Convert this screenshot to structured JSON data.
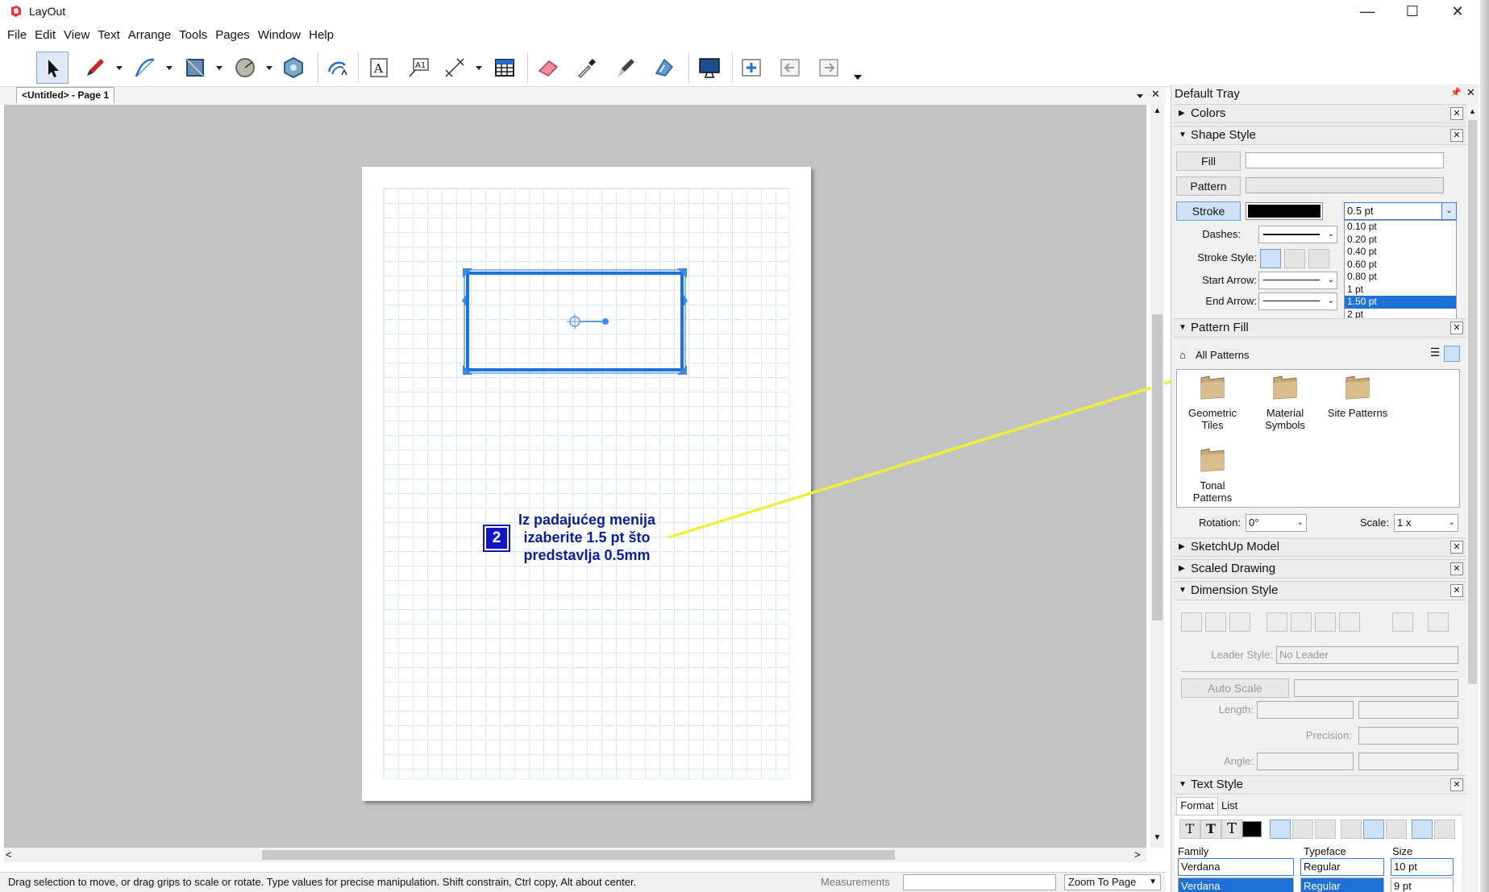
{
  "window": {
    "title": "LayOut",
    "minimize": "—",
    "maximize": "☐",
    "close": "✕"
  },
  "menu": [
    "File",
    "Edit",
    "View",
    "Text",
    "Arrange",
    "Tools",
    "Pages",
    "Window",
    "Help"
  ],
  "toolbar": {
    "icons": [
      "select-arrow-icon",
      "pencil-icon",
      "freehand-icon",
      "rectangle-icon",
      "circle-icon",
      "polygon-icon",
      "arc-icon",
      "text-icon",
      "label-icon",
      "dimension-icon",
      "table-icon",
      "eraser-icon",
      "eyedropper-icon",
      "split-pen-icon",
      "join-icon",
      "presentation-icon",
      "add-page-icon",
      "previous-page-icon",
      "next-page-icon"
    ]
  },
  "tab": {
    "label": "<Untitled> - Page 1"
  },
  "annotation": {
    "step": "2",
    "line1": "Iz padajućeg menija",
    "line2": "izaberite 1.5 pt što",
    "line3": "predstavlja 0.5mm",
    "color": "#0a1e96",
    "arrow_color": "#f0ee3a"
  },
  "status": {
    "hint": "Drag selection to move, or drag grips to scale or rotate. Type values for precise manipulation. Shift constrain, Ctrl copy, Alt about center.",
    "measurements_label": "Measurements",
    "zoom": "Zoom To Page"
  },
  "tray": {
    "title": "Default Tray",
    "colors": {
      "title": "Colors"
    },
    "shape_style": {
      "title": "Shape Style",
      "fill": "Fill",
      "pattern": "Pattern",
      "stroke": "Stroke",
      "stroke_width": "0.5 pt",
      "stroke_color": "#000000",
      "dashes": "Dashes:",
      "stroke_style": "Stroke Style:",
      "start_arrow": "Start Arrow:",
      "end_arrow": "End Arrow:",
      "width_options": [
        "0.10 pt",
        "0.20 pt",
        "0.40 pt",
        "0.60 pt",
        "0.80 pt",
        "1 pt",
        "1.50 pt",
        "2 pt"
      ],
      "selected_option": "1.50 pt"
    },
    "pattern_fill": {
      "title": "Pattern Fill",
      "location": "All Patterns",
      "folders": [
        "Geometric Tiles",
        "Material Symbols",
        "Site Patterns",
        "Tonal Patterns"
      ],
      "rotation_label": "Rotation:",
      "rotation": "0°",
      "scale_label": "Scale:",
      "scale": "1 x"
    },
    "sketchup_model": {
      "title": "SketchUp Model"
    },
    "scaled_drawing": {
      "title": "Scaled Drawing"
    },
    "dimension_style": {
      "title": "Dimension Style",
      "leader_style_label": "Leader Style:",
      "leader_style": "No Leader",
      "auto_scale": "Auto Scale",
      "length_label": "Length:",
      "precision_label": "Precision:",
      "angle_label": "Angle:"
    },
    "text_style": {
      "title": "Text Style",
      "tab_format": "Format",
      "tab_list": "List",
      "family_label": "Family",
      "typeface_label": "Typeface",
      "size_label": "Size",
      "family": "Verdana",
      "typeface": "Regular",
      "size": "10 pt",
      "family_list_top": "Verdana",
      "typeface_list_top": "Regular",
      "size_list_top": "9 pt"
    }
  }
}
